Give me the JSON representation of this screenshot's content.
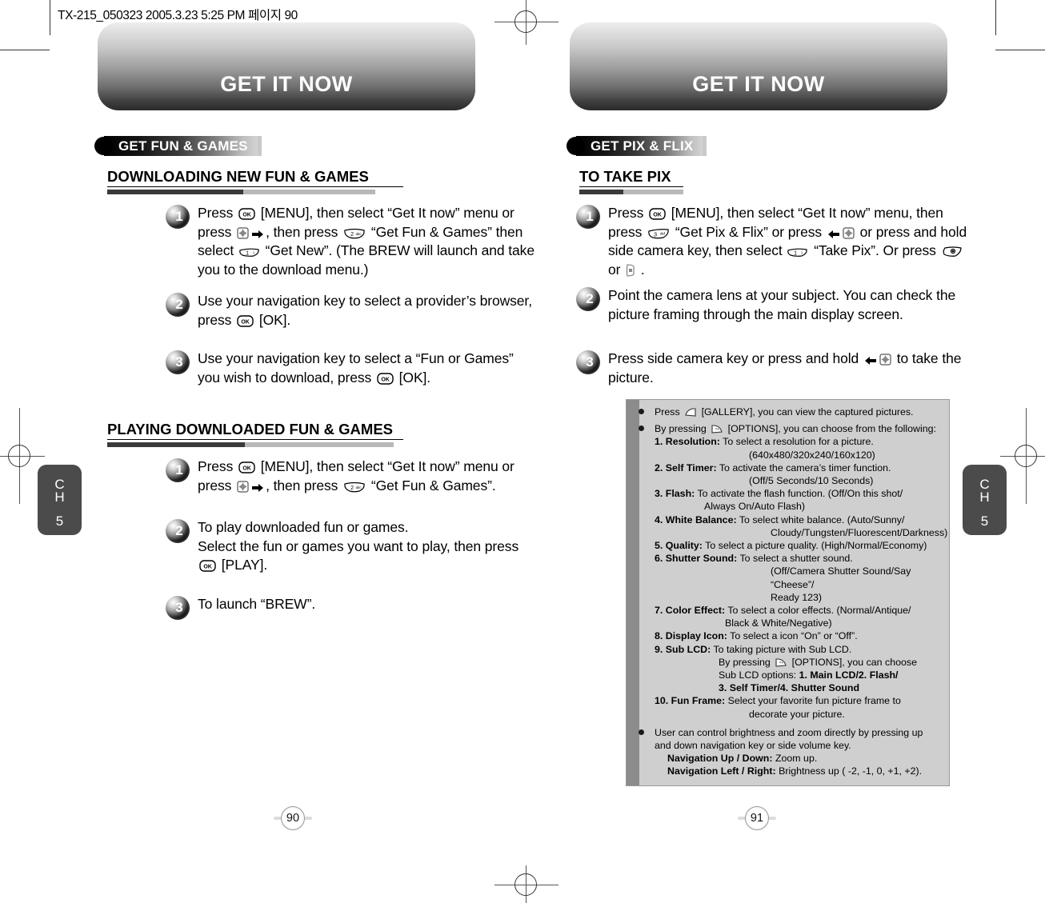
{
  "meta": {
    "file_header": "TX-215_050323  2005.3.23 5:25 PM 페이지 90"
  },
  "left_page": {
    "title": "GET IT NOW",
    "badge": "GET FUN & GAMES",
    "sections": [
      {
        "heading": "DOWNLOADING NEW FUN & GAMES",
        "steps": [
          {
            "num": "1",
            "text": "Press [OK] [MENU], then select “Get It now” menu or press [NAV] ➡, then press [2abc] “Get Fun & Games” then select [1] “Get New”. (The BREW will launch and take you to the download menu.)"
          },
          {
            "num": "2",
            "text": "Use your navigation key to select a provider’s browser, press [OK] [OK]."
          },
          {
            "num": "3",
            "text": "Use your navigation key to select a “Fun or Games” you wish to download, press [OK] [OK]."
          }
        ]
      },
      {
        "heading": "PLAYING DOWNLOADED FUN & GAMES",
        "steps": [
          {
            "num": "1",
            "text": "Press [OK] [MENU], then select “Get It now” menu or press [NAV] ➡, then press [2abc] “Get Fun & Games”."
          },
          {
            "num": "2",
            "text": "To play downloaded fun or games. Select the fun or games you want to play, then press [OK] [PLAY]."
          },
          {
            "num": "3",
            "text": "To launch “BREW”."
          }
        ]
      }
    ],
    "page_number": "90",
    "chapter_tab": {
      "line1": "C",
      "line2": "H",
      "line3": "5"
    }
  },
  "right_page": {
    "title": "GET IT NOW",
    "badge": "GET PIX & FLIX",
    "sections": [
      {
        "heading": "TO TAKE PIX",
        "steps": [
          {
            "num": "1",
            "text": "Press [OK] [MENU], then select “Get It now” menu, then press [3def] “Get Pix & Flix” or press ⬅[NAV] or press and hold side camera key, then select [1] “Take Pix”. Or press [CAM] or [SIDECAM] ."
          },
          {
            "num": "2",
            "text": "Point the camera lens at your subject. You can check the picture framing through the main display screen."
          },
          {
            "num": "3",
            "text": "Press side camera key or press and hold ⬅[NAV] to take the picture."
          }
        ]
      }
    ],
    "options_box": {
      "bullet1": "Press [GALLERY-KEY] [GALLERY], you can view the captured pictures.",
      "bullet2_intro": "By pressing [OPTIONS-KEY] [OPTIONS], you can choose from the following:",
      "options": [
        {
          "label": "1. Resolution:",
          "desc": "To select a resolution for a picture.",
          "cont": [
            "(640x480/320x240/160x120)"
          ],
          "cont_indent": [
            118
          ]
        },
        {
          "label": "2. Self Timer:",
          "desc": "To activate the camera’s timer function.",
          "cont": [
            "(Off/5 Seconds/10 Seconds)"
          ],
          "cont_indent": [
            118
          ]
        },
        {
          "label": "3. Flash:",
          "desc": "To activate the flash function. (Off/On this shot/",
          "cont": [
            "Always On/Auto Flash)"
          ],
          "cont_indent": [
            62
          ]
        },
        {
          "label": "4. White Balance:",
          "desc": "To select white balance. (Auto/Sunny/",
          "cont": [
            "Cloudy/Tungsten/Fluorescent/Darkness)"
          ],
          "cont_indent": [
            145
          ]
        },
        {
          "label": "5. Quality:",
          "desc": "To select a picture quality. (High/Normal/Economy)",
          "cont": [],
          "cont_indent": []
        },
        {
          "label": "6. Shutter Sound:",
          "desc": "To select a shutter sound.",
          "cont": [
            "(Off/Camera Shutter Sound/Say “Cheese”/",
            "Ready 123)"
          ],
          "cont_indent": [
            145,
            145
          ]
        },
        {
          "label": "7. Color Effect:",
          "desc": "To select a color effects. (Normal/Antique/",
          "cont": [
            "Black & White/Negative)"
          ],
          "cont_indent": [
            88
          ]
        },
        {
          "label": "8. Display Icon:",
          "desc": "To select a icon “On” or “Off”.",
          "cont": [],
          "cont_indent": []
        },
        {
          "label": "9. Sub LCD:",
          "desc": "To taking picture with Sub LCD.",
          "cont": [],
          "cont_indent": []
        },
        {
          "label": "10. Fun Frame:",
          "desc": "Select your favorite fun picture frame to",
          "cont": [
            "decorate your picture."
          ],
          "cont_indent": [
            118
          ]
        }
      ],
      "sublcd_lines": [
        "By pressing [OPTIONS-KEY] [OPTIONS], you can choose",
        "Sub LCD options: 1. Main LCD/2. Flash/",
        "3. Self Timer/4. Shutter Sound"
      ],
      "bullet3_line1": "User can control brightness and zoom directly by pressing up",
      "bullet3_line2": "and down navigation key or side volume key.",
      "nav_updown_label": "Navigation Up / Down:",
      "nav_updown_desc": "Zoom up.",
      "nav_lr_label": "Navigation Left / Right:",
      "nav_lr_desc": "Brightness up ( -2, -1, 0, +1, +2)."
    },
    "page_number": "91",
    "chapter_tab": {
      "line1": "C",
      "line2": "H",
      "line3": "5"
    }
  },
  "colors": {
    "badge_dark": "#000000",
    "badge_light": "#d3d3d3",
    "tab_bg": "#4b4b4b",
    "optbox_bg": "#cfcfcf",
    "optbox_bar": "#8c8c8c"
  }
}
